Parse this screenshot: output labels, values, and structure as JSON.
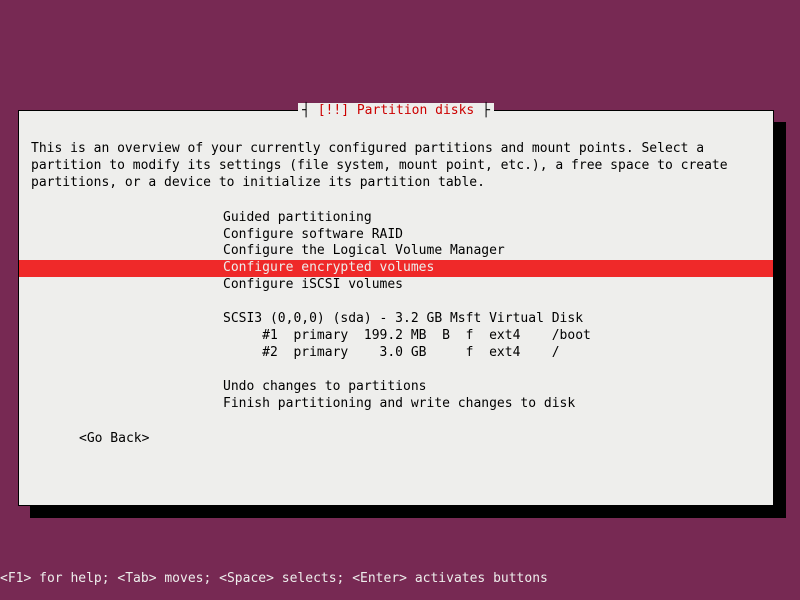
{
  "dialog": {
    "title_prefix": "[!!]",
    "title": "Partition disks",
    "description": "This is an overview of your currently configured partitions and mount points. Select a\npartition to modify its settings (file system, mount point, etc.), a free space to create\npartitions, or a device to initialize its partition table."
  },
  "menu": {
    "options": [
      "Guided partitioning",
      "Configure software RAID",
      "Configure the Logical Volume Manager",
      "Configure encrypted volumes",
      "Configure iSCSI volumes"
    ],
    "selected_index": 3,
    "disk_header": "SCSI3 (0,0,0) (sda) - 3.2 GB Msft Virtual Disk",
    "partitions": [
      "     #1  primary  199.2 MB  B  f  ext4    /boot",
      "     #2  primary    3.0 GB     f  ext4    /"
    ],
    "actions": [
      "Undo changes to partitions",
      "Finish partitioning and write changes to disk"
    ],
    "go_back": "<Go Back>"
  },
  "footer": {
    "help_text": "<F1> for help; <Tab> moves; <Space> selects; <Enter> activates buttons"
  }
}
